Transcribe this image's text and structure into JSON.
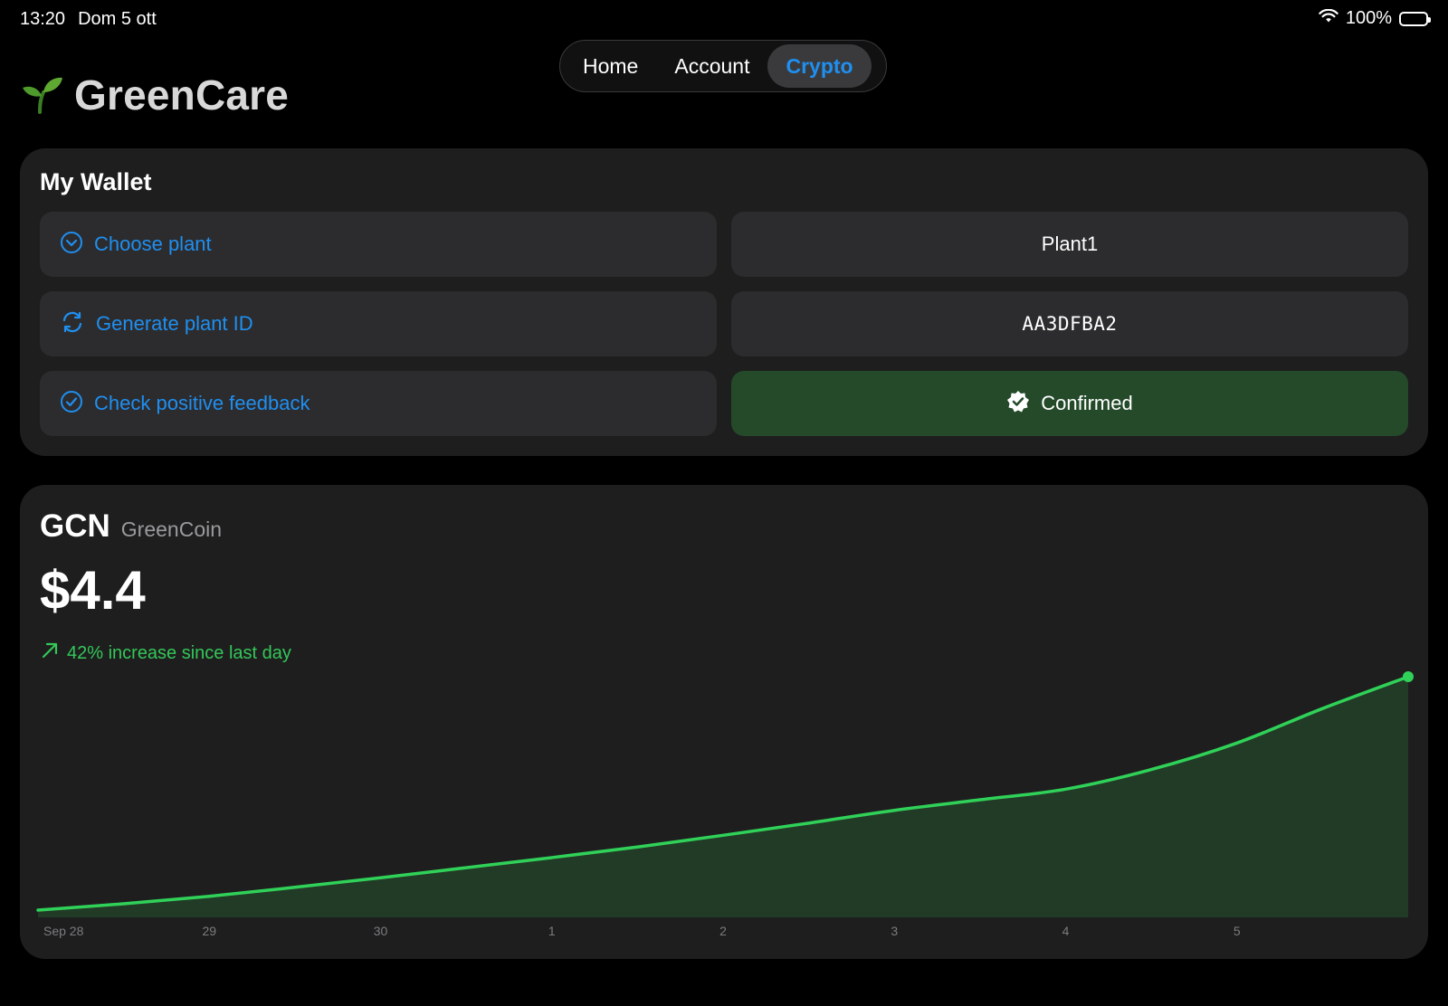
{
  "status_bar": {
    "time": "13:20",
    "date": "Dom 5 ott",
    "battery": "100%"
  },
  "brand": {
    "title": "GreenCare",
    "icon": "sprout-icon"
  },
  "nav": {
    "tabs": [
      {
        "label": "Home",
        "active": false
      },
      {
        "label": "Account",
        "active": false
      },
      {
        "label": "Crypto",
        "active": true
      }
    ]
  },
  "wallet": {
    "title": "My Wallet",
    "actions": [
      {
        "label": "Choose plant",
        "icon": "chevron-down-circle-icon"
      },
      {
        "label": "Generate plant ID",
        "icon": "refresh-icon"
      },
      {
        "label": "Check positive feedback",
        "icon": "check-circle-icon"
      }
    ],
    "values": {
      "plant": "Plant1",
      "plant_id": "AA3DFBA2",
      "feedback": "Confirmed"
    }
  },
  "coin": {
    "symbol": "GCN",
    "name": "GreenCoin",
    "price": "$4.4",
    "change_text": "42% increase since last day"
  },
  "colors": {
    "accent_blue": "#1f8ff0",
    "green": "#34c759",
    "confirmed_bg": "#244a2a",
    "card_bg": "#1e1e1e"
  },
  "chart_data": {
    "type": "area",
    "x_tick_labels": [
      "Sep 28",
      "29",
      "30",
      "1",
      "2",
      "3",
      "4",
      "5"
    ],
    "x": [
      0,
      0.5,
      1,
      1.5,
      2,
      2.5,
      3,
      3.5,
      4,
      4.5,
      5,
      5.5,
      6,
      6.5,
      7,
      7.5,
      8
    ],
    "values": [
      0.0,
      0.12,
      0.26,
      0.43,
      0.61,
      0.8,
      0.99,
      1.19,
      1.41,
      1.64,
      1.88,
      2.08,
      2.28,
      2.65,
      3.15,
      3.8,
      4.4
    ],
    "ylim": [
      0,
      4.4
    ],
    "xlabel": "",
    "ylabel": "",
    "grid": false,
    "line_color": "#30d158",
    "fill_color": "#213b26"
  }
}
